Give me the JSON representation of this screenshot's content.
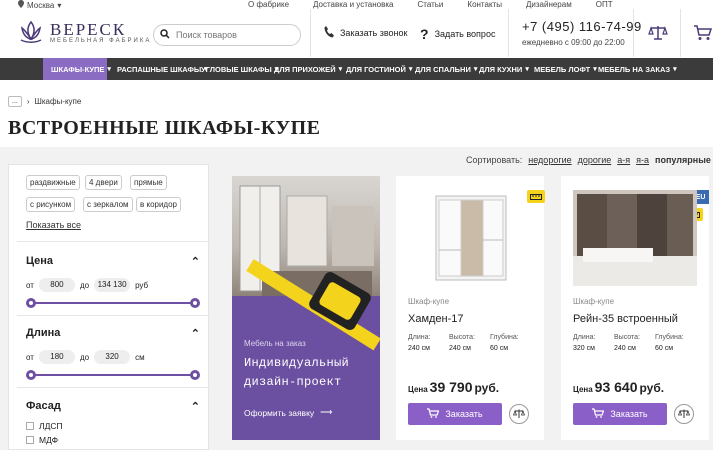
{
  "topbar": {
    "city": "Москва",
    "links": [
      "О фабрике",
      "Доставка и установка",
      "Статьи",
      "Контакты",
      "Дизайнерам",
      "ОПТ"
    ]
  },
  "header": {
    "logo_name": "ВЕРЕСК",
    "logo_sub": "МЕБЕЛЬНАЯ ФАБРИКА",
    "search_placeholder": "Поиск товаров",
    "callback_label": "Заказать звонок",
    "ask_label": "Задать вопрос",
    "phone": "+7 (495) 116-74-99",
    "hours": "ежедневно с 09:00 до 22:00"
  },
  "nav": {
    "items": [
      {
        "label": "Шкафы-купе",
        "active": true
      },
      {
        "label": "Распашные шкафы"
      },
      {
        "label": "Угловые шкафы"
      },
      {
        "label": "Для прихожей"
      },
      {
        "label": "Для гостиной"
      },
      {
        "label": "Для спальни"
      },
      {
        "label": "Для кухни"
      },
      {
        "label": "Мебель лофт"
      },
      {
        "label": "Мебель на заказ"
      }
    ]
  },
  "breadcrumbs": {
    "more": "...",
    "current": "Шкафы-купе"
  },
  "page_title": "ВСТРОЕННЫЕ ШКАФЫ-КУПЕ",
  "sort": {
    "label": "Сортировать:",
    "options": [
      "недорогие",
      "дорогие",
      "а-я",
      "я-а",
      "популярные"
    ]
  },
  "filter": {
    "chips": [
      "раздвижные",
      "4 двери",
      "прямые",
      "с рисунком",
      "с зеркалом",
      "в коридор"
    ],
    "show_all": "Показать все",
    "price": {
      "title": "Цена",
      "from_label": "от",
      "from": "800",
      "to_label": "до",
      "to": "134 130",
      "unit": "руб"
    },
    "length": {
      "title": "Длина",
      "from_label": "от",
      "from": "180",
      "to_label": "до",
      "to": "320",
      "unit": "см"
    },
    "facade": {
      "title": "Фасад",
      "options": [
        "ЛДСП",
        "МДФ"
      ]
    }
  },
  "promo": {
    "label": "Мебель на заказ",
    "title_line1": "Индивидуальный",
    "title_line2": "дизайн-проект",
    "cta": "Оформить заявку"
  },
  "products": [
    {
      "category": "Шкаф-купе",
      "name": "Хамден-17",
      "specs": [
        {
          "label": "Длина:",
          "value": "240 см"
        },
        {
          "label": "Высота:",
          "value": "240 см"
        },
        {
          "label": "Глубина:",
          "value": "60 см"
        }
      ],
      "price_label": "Цена",
      "price": "39 790",
      "currency": "руб.",
      "buy_label": "Заказать"
    },
    {
      "category": "Шкаф-купе",
      "name": "Рейн-35 встроенный",
      "specs": [
        {
          "label": "Длина:",
          "value": "320 см"
        },
        {
          "label": "Высота:",
          "value": "240 см"
        },
        {
          "label": "Глубина:",
          "value": "60 см"
        }
      ],
      "price_label": "Цена",
      "price": "93 640",
      "currency": "руб.",
      "buy_label": "Заказать",
      "badge": "EU"
    }
  ],
  "colors": {
    "accent": "#8a5fc7",
    "nav_bg": "#3b3b3b",
    "nav_active": "#8a6cc2",
    "promo_bg": "#6b4fa0",
    "tape": "#f4d31c"
  }
}
